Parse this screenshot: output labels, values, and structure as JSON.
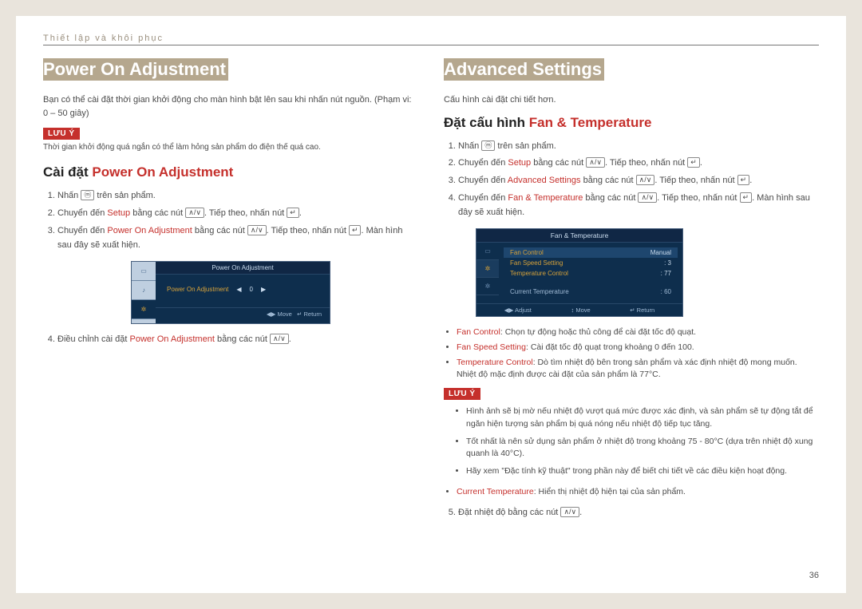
{
  "header": {
    "section_path": "Thiết lập và khôi phục"
  },
  "page_number": "36",
  "left": {
    "title": "Power On Adjustment",
    "intro": "Bạn có thể cài đặt thời gian khởi động cho màn hình bật lên sau khi nhấn nút nguồn. (Phạm vi: 0 – 50 giây)",
    "note_label": "LƯU Ý",
    "note_text": "Thời gian khởi động quá ngắn có thể làm hỏng sản phẩm do điện thế quá cao.",
    "subhead_black": "Cài đặt ",
    "subhead_red": "Power On Adjustment",
    "steps": {
      "s1a": "Nhấn ",
      "s1b": " trên sản phẩm.",
      "s2a": "Chuyển đến ",
      "s2b": "Setup",
      "s2c": " bằng các nút ",
      "s2d": ". Tiếp theo, nhấn nút ",
      "s2e": ".",
      "s3a": "Chuyển đến ",
      "s3b": "Power On Adjustment",
      "s3c": " bằng các nút ",
      "s3d": ". Tiếp theo, nhấn nút ",
      "s3e": ". Màn hình sau đây sẽ xuất hiện.",
      "s4a": "Điều chỉnh cài đặt ",
      "s4b": "Power On Adjustment",
      "s4c": " bằng các nút ",
      "s4d": "."
    },
    "osd": {
      "title": "Power On Adjustment",
      "row_label": "Power On Adjustment",
      "row_value": "0",
      "foot_move": "Move",
      "foot_return": "Return"
    }
  },
  "right": {
    "title": "Advanced Settings",
    "intro": "Cấu hình cài đặt chi tiết hơn.",
    "subhead_black": "Đặt cấu hình ",
    "subhead_red": "Fan & Temperature",
    "steps": {
      "s1a": "Nhấn ",
      "s1b": " trên sản phẩm.",
      "s2a": "Chuyển đến ",
      "s2b": "Setup",
      "s2c": " bằng các nút ",
      "s2d": ". Tiếp theo, nhấn nút ",
      "s2e": ".",
      "s3a": "Chuyển đến ",
      "s3b": "Advanced Settings",
      "s3c": " bằng các nút ",
      "s3d": ". Tiếp theo, nhấn nút ",
      "s3e": ".",
      "s4a": "Chuyển đến ",
      "s4b": "Fan & Temperature",
      "s4c": " bằng các nút ",
      "s4d": ". Tiếp theo, nhấn nút ",
      "s4e": ". Màn hình sau đây sẽ xuất hiện."
    },
    "osd": {
      "title": "Fan & Temperature",
      "r1_lbl": "Fan Control",
      "r1_val": "Manual",
      "r2_lbl": "Fan Speed Setting",
      "r2_val": ": 3",
      "r3_lbl": "Temperature Control",
      "r3_val": ": 77",
      "r4_lbl": "Current Temperature",
      "r4_val": ": 60",
      "foot_adjust": "Adjust",
      "foot_move": "Move",
      "foot_return": "Return"
    },
    "bullets": {
      "b1_key": "Fan Control",
      "b1_txt": ": Chọn tự động hoặc thủ công để cài đặt tốc độ quạt.",
      "b2_key": "Fan Speed Setting",
      "b2_txt": ": Cài đặt tốc độ quạt trong khoảng 0 đến 100.",
      "b3_key": "Temperature Control",
      "b3_txt": ": Dò tìm nhiệt độ bên trong sản phẩm và xác định nhiệt độ mong muốn. Nhiệt độ mặc định được cài đặt của sản phẩm là 77°C."
    },
    "note_label": "LƯU Ý",
    "notes": {
      "n1": "Hình ảnh sẽ bị mờ nếu nhiệt độ vượt quá mức được xác định, và sản phẩm sẽ tự động tắt để ngăn hiện tượng sản phẩm bị quá nóng nếu nhiệt độ tiếp tục tăng.",
      "n2": "Tốt nhất là nên sử dụng sản phẩm ở nhiệt độ trong khoảng 75 - 80°C (dựa trên nhiệt độ xung quanh là 40°C).",
      "n3": "Hãy xem \"Đặc tính kỹ thuật\" trong phần này để biết chi tiết về các điều kiện hoạt động."
    },
    "bullets2": {
      "b4_key": "Current Temperature",
      "b4_txt": ": Hiển thị nhiệt độ hiện tại của sản phẩm."
    },
    "step5a": "Đặt nhiệt độ bằng các nút ",
    "step5b": "."
  },
  "icons": {
    "menu": "ⓜ",
    "updown": "∧/∨",
    "enter": "↵"
  }
}
